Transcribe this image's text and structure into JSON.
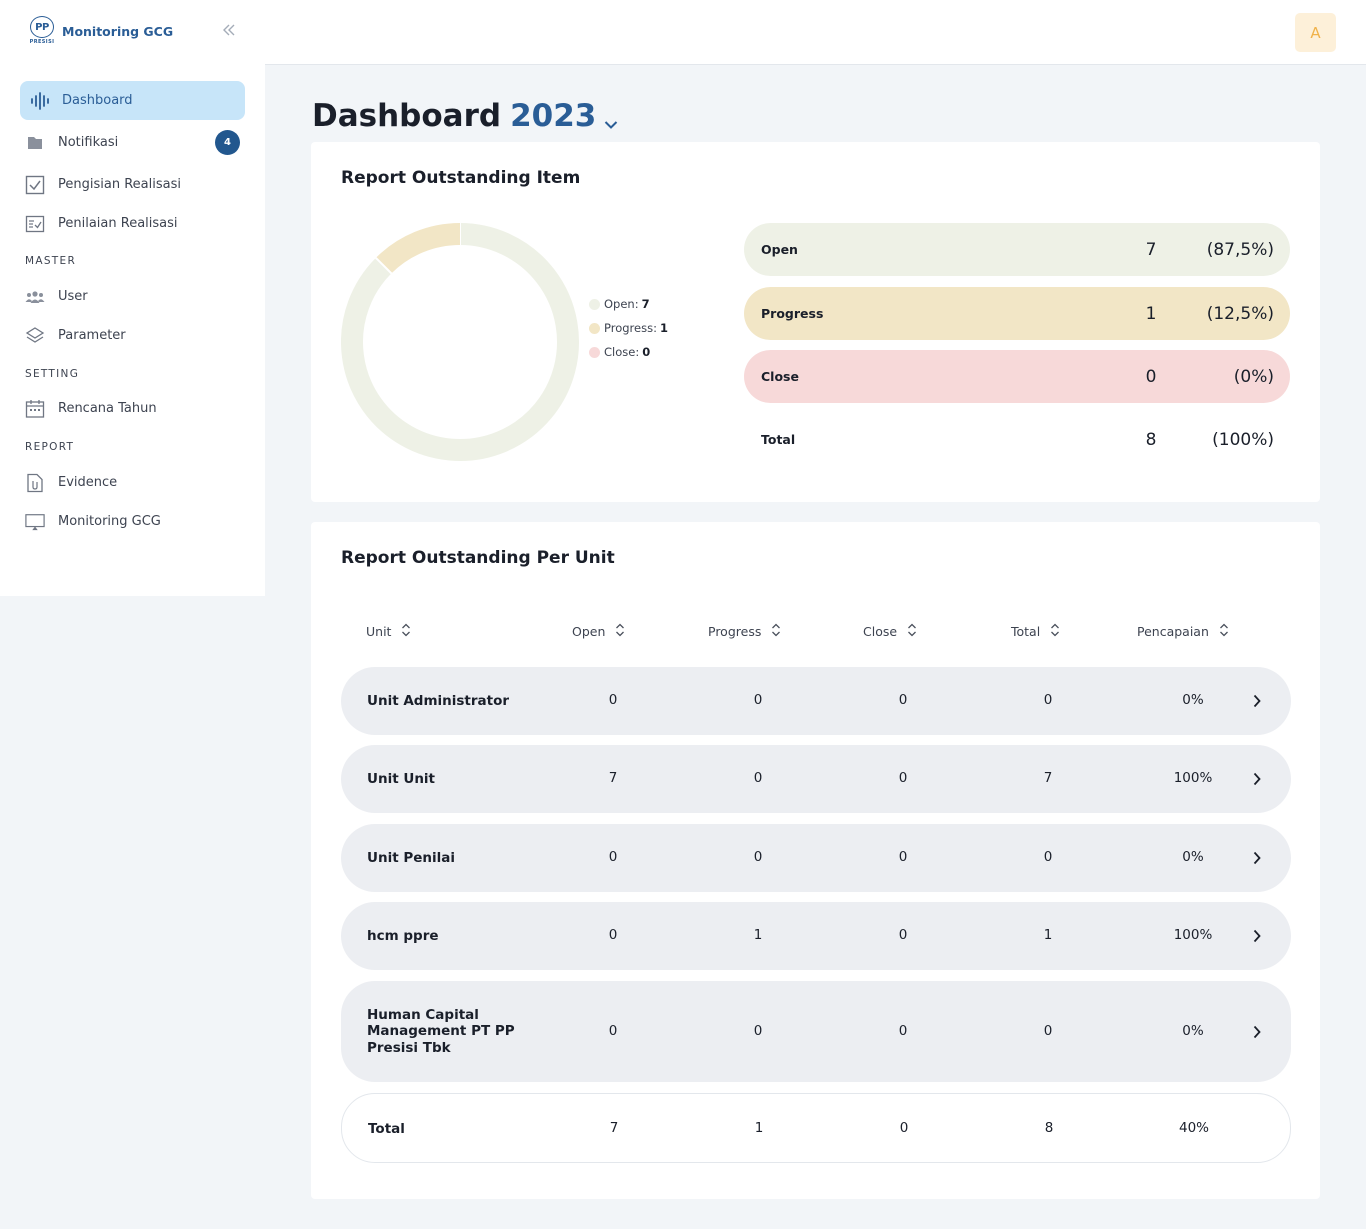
{
  "brand": {
    "logo_text": "PP",
    "logo_sub": "PRESISI",
    "name": "Monitoring GCG"
  },
  "sidebar": {
    "items": [
      {
        "label": "Dashboard",
        "icon": "waveform-icon",
        "active": true
      },
      {
        "label": "Notifikasi",
        "icon": "folder-icon",
        "badge": "4"
      },
      {
        "label": "Pengisian Realisasi",
        "icon": "checkbox-icon"
      },
      {
        "label": "Penilaian Realisasi",
        "icon": "checklist-icon"
      }
    ],
    "sections": [
      {
        "title": "MASTER",
        "items": [
          {
            "label": "User",
            "icon": "users-icon"
          },
          {
            "label": "Parameter",
            "icon": "layers-icon"
          }
        ]
      },
      {
        "title": "SETTING",
        "items": [
          {
            "label": "Rencana Tahun",
            "icon": "calendar-icon"
          }
        ]
      },
      {
        "title": "REPORT",
        "items": [
          {
            "label": "Evidence",
            "icon": "file-attachment-icon"
          },
          {
            "label": "Monitoring GCG",
            "icon": "monitor-icon"
          }
        ]
      }
    ]
  },
  "topbar": {
    "avatar_initial": "A"
  },
  "page": {
    "title": "Dashboard",
    "year": "2023"
  },
  "colors": {
    "open": "#eef1e6",
    "progress": "#f2e6c6",
    "close": "#f7d9d9",
    "accent": "#2a5d96",
    "badge": "#22578e"
  },
  "outstanding": {
    "title": "Report Outstanding Item",
    "legend": [
      {
        "label": "Open:",
        "value": "7"
      },
      {
        "label": "Progress:",
        "value": "1"
      },
      {
        "label": "Close:",
        "value": "0"
      }
    ],
    "summary": [
      {
        "label": "Open",
        "count": "7",
        "pct": "(87,5%)"
      },
      {
        "label": "Progress",
        "count": "1",
        "pct": "(12,5%)"
      },
      {
        "label": "Close",
        "count": "0",
        "pct": "(0%)"
      },
      {
        "label": "Total",
        "count": "8",
        "pct": "(100%)"
      }
    ]
  },
  "chart_data": {
    "type": "pie",
    "categories": [
      "Open",
      "Progress",
      "Close"
    ],
    "values": [
      7,
      1,
      0
    ],
    "colors": [
      "#eef1e6",
      "#f2e6c6",
      "#f7d9d9"
    ],
    "legend": "right"
  },
  "per_unit": {
    "title": "Report Outstanding Per Unit",
    "headers": [
      "Unit",
      "Open",
      "Progress",
      "Close",
      "Total",
      "Pencapaian"
    ],
    "rows": [
      {
        "unit": "Unit Administrator",
        "open": "0",
        "progress": "0",
        "close": "0",
        "total": "0",
        "pencapaian": "0%"
      },
      {
        "unit": "Unit Unit",
        "open": "7",
        "progress": "0",
        "close": "0",
        "total": "7",
        "pencapaian": "100%"
      },
      {
        "unit": "Unit Penilai",
        "open": "0",
        "progress": "0",
        "close": "0",
        "total": "0",
        "pencapaian": "0%"
      },
      {
        "unit": "hcm ppre",
        "open": "0",
        "progress": "1",
        "close": "0",
        "total": "1",
        "pencapaian": "100%"
      },
      {
        "unit": "Human Capital Management PT PP Presisi Tbk",
        "open": "0",
        "progress": "0",
        "close": "0",
        "total": "0",
        "pencapaian": "0%"
      }
    ],
    "total": {
      "unit": "Total",
      "open": "7",
      "progress": "1",
      "close": "0",
      "total": "8",
      "pencapaian": "40%"
    }
  }
}
